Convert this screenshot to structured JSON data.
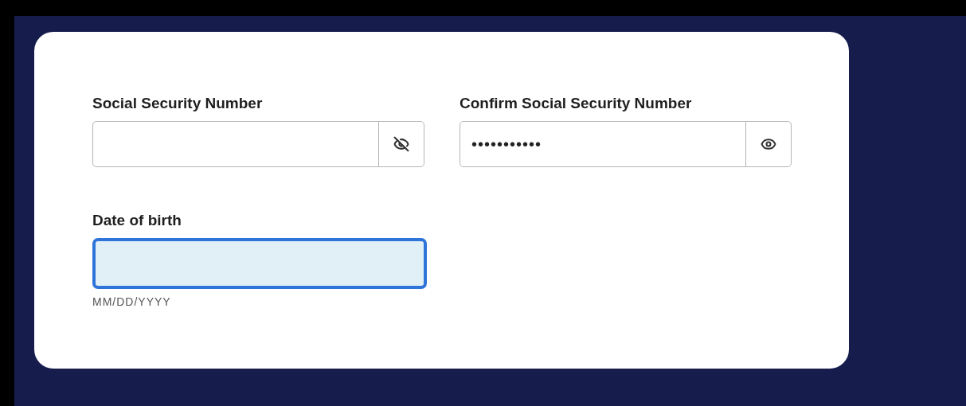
{
  "fields": [
    {
      "label": "Social Security Number",
      "kind": "secret",
      "visible": true
    },
    {
      "label": "Confirm Social Security Number",
      "kind": "secret",
      "visible": false,
      "value": "•••••••••••"
    },
    {
      "label": "Date of birth",
      "kind": "date",
      "focused": true,
      "hint": "MM/DD/YYYY"
    }
  ]
}
